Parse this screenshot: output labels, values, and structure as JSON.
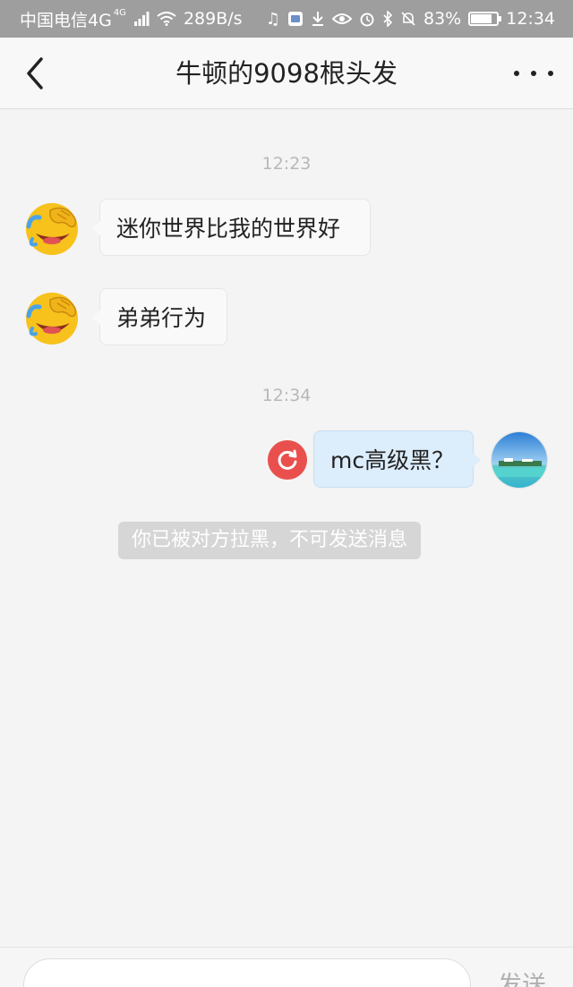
{
  "status_bar": {
    "carrier": "中国电信4G",
    "net_badge": "4G",
    "speed": "289B/s",
    "battery": "83%",
    "battery_level": 0.83,
    "time": "12:34"
  },
  "nav": {
    "title": "牛顿的9098根头发"
  },
  "chat": {
    "time_1": "12:23",
    "msg_1": "迷你世界比我的世界好",
    "msg_2": "弟弟行为",
    "time_2": "12:34",
    "msg_3": "mc高级黑？",
    "notice": "你已被对方拉黑，不可发送消息"
  },
  "input_bar": {
    "send_label": "发送"
  },
  "colors": {
    "status_bar_bg": "#9e9e9e",
    "outgoing_bubble": "#dcedfb",
    "retry_red": "#e9504d",
    "notice_bg": "#d6d6d6"
  }
}
